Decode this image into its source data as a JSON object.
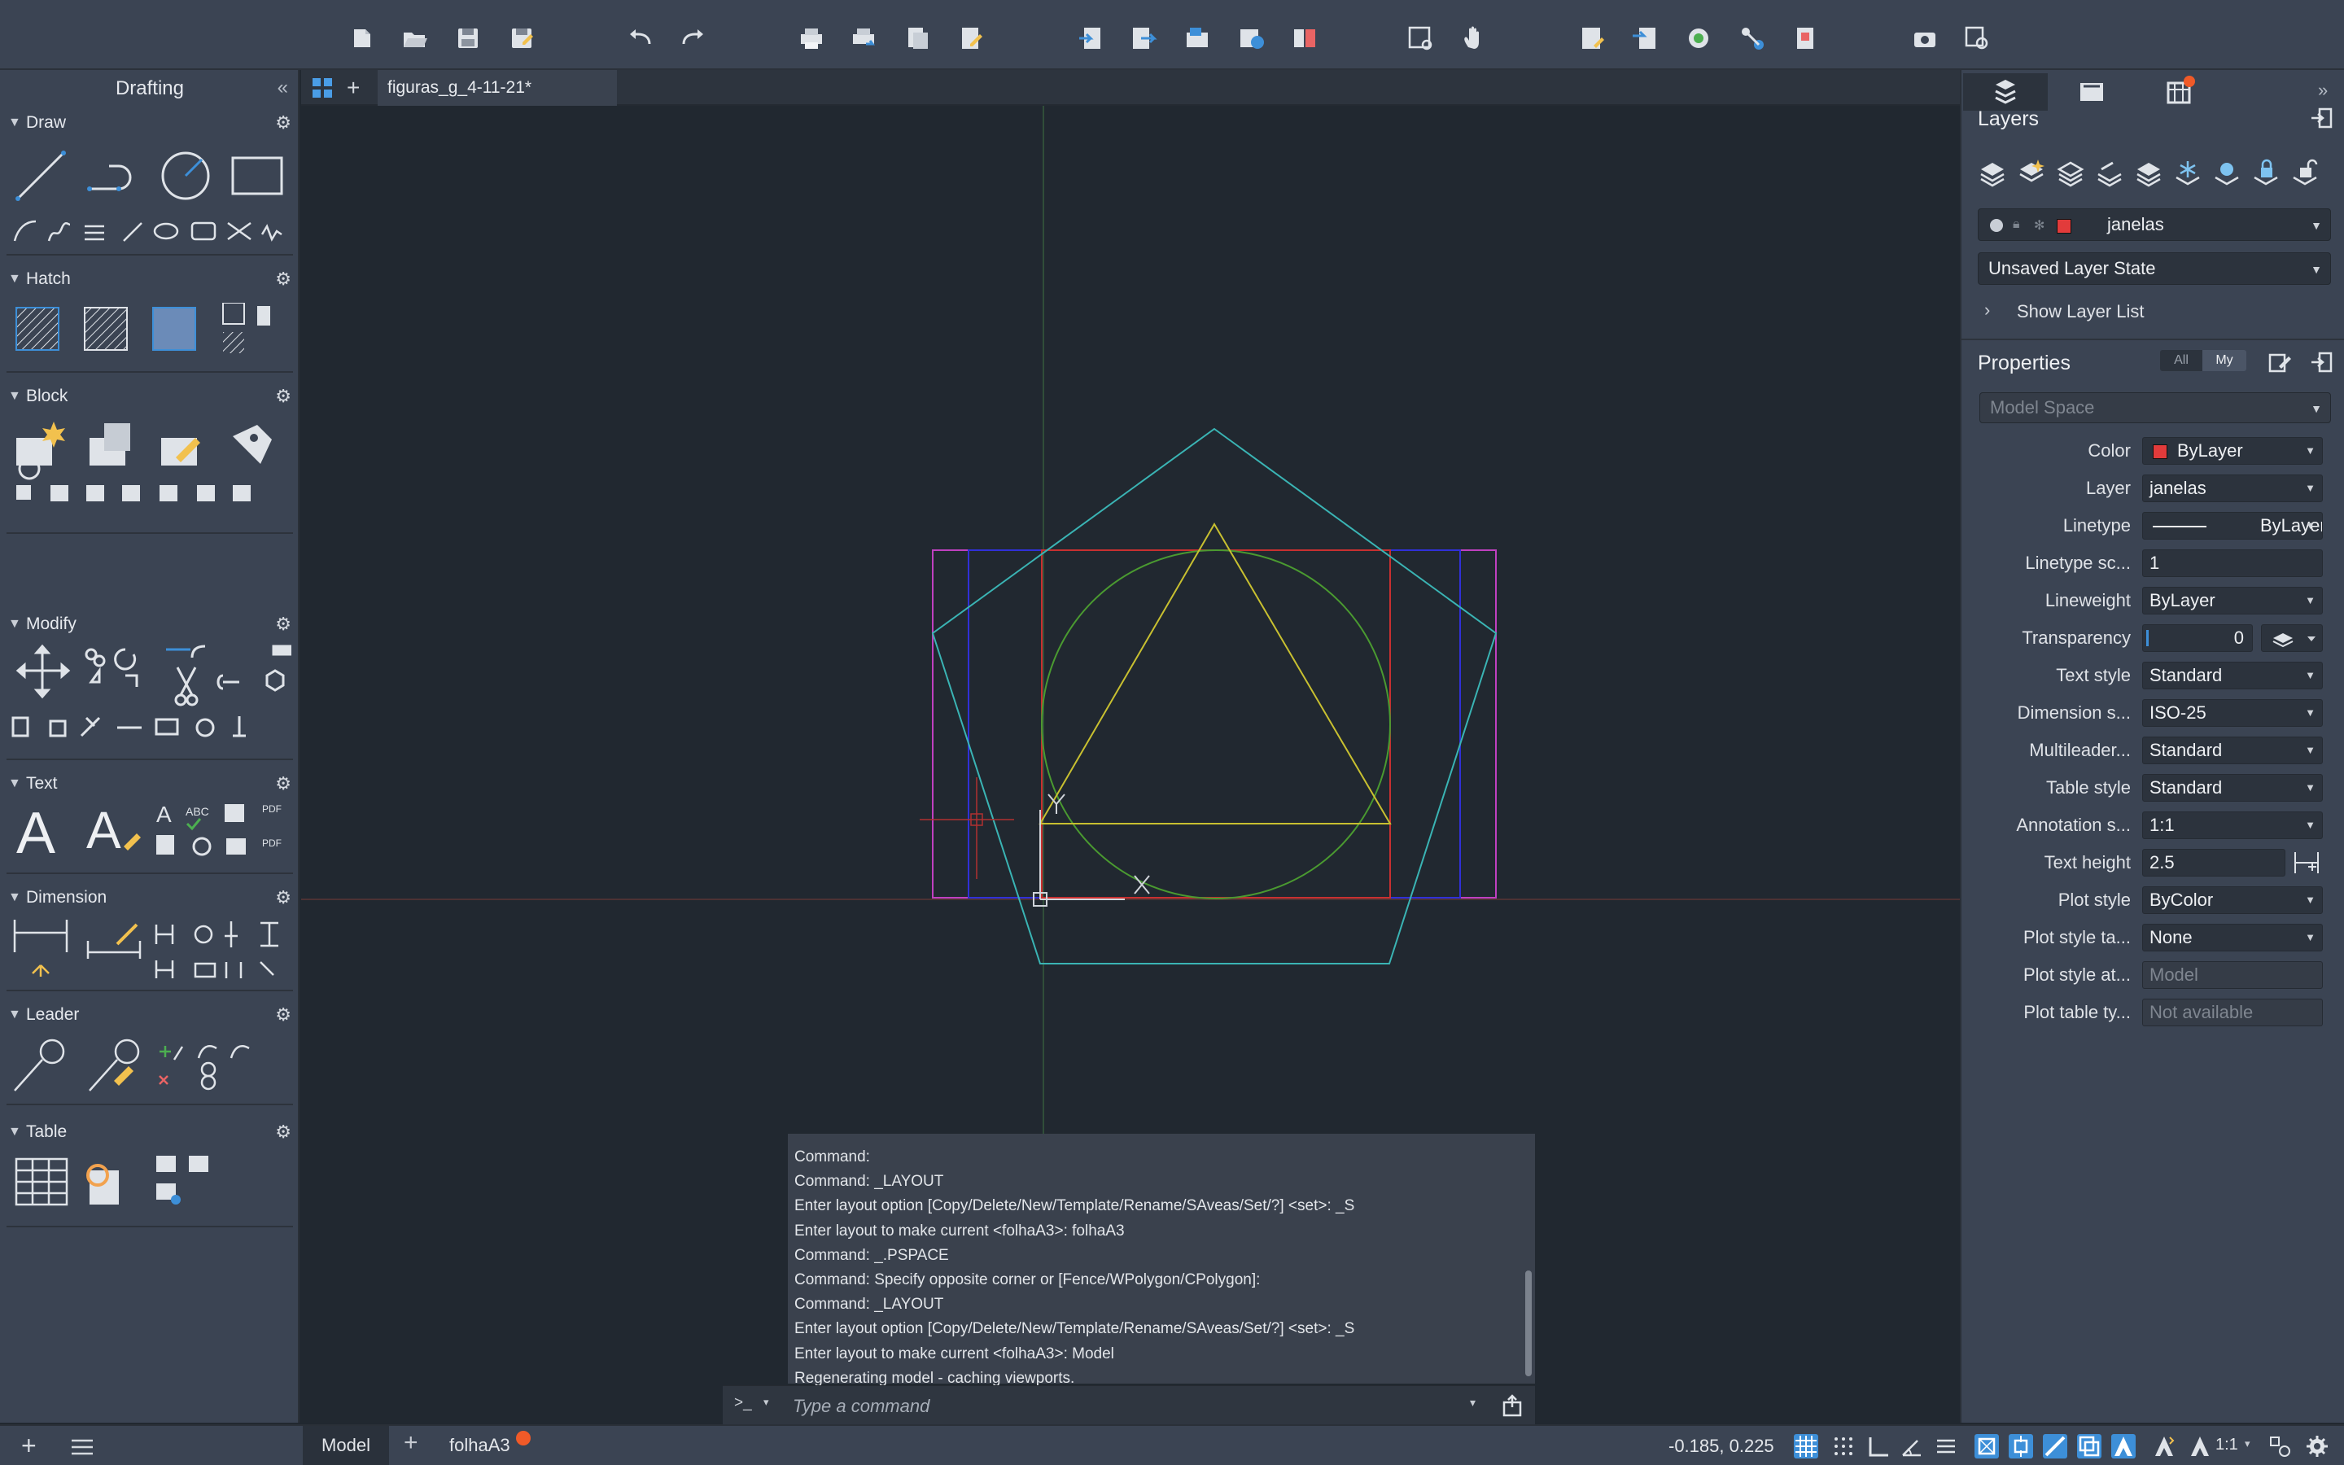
{
  "toolbar": {
    "icons": [
      "new-file",
      "open-file",
      "save",
      "save-as",
      "undo",
      "redo",
      "plot",
      "batch-plot",
      "plot-preview",
      "page-setup",
      "import",
      "export",
      "publish",
      "share",
      "compare",
      "zoom-window",
      "pan",
      "layer-properties",
      "match-layer",
      "xref",
      "attach",
      "insert",
      "camera",
      "find"
    ]
  },
  "palette": {
    "title": "Drafting",
    "collapse_glyph": "«",
    "sections": {
      "draw": "Draw",
      "hatch": "Hatch",
      "block": "Block",
      "modify": "Modify",
      "text": "Text",
      "dimension": "Dimension",
      "leader": "Leader",
      "table": "Table"
    }
  },
  "doc": {
    "tab_title": "figuras_g_4-11-21*"
  },
  "command": {
    "history": [
      "Command:",
      "Command: _LAYOUT",
      "Enter layout option [Copy/Delete/New/Template/Rename/SAveas/Set/?] <set>: _S",
      "Enter layout to make current <folhaA3>: folhaA3",
      "Command: _.PSPACE",
      "Command: Specify opposite corner or [Fence/WPolygon/CPolygon]:",
      "Command: _LAYOUT",
      "Enter layout option [Copy/Delete/New/Template/Rename/SAveas/Set/?] <set>: _S",
      "Enter layout to make current <folhaA3>: Model",
      "Regenerating model - caching viewports."
    ],
    "prompt_glyph": ">_",
    "placeholder": "Type a command"
  },
  "bottom": {
    "model_tab": "Model",
    "layout_tab": "folhaA3",
    "coords": "-0.185, 0.225",
    "scale": "1:1"
  },
  "layers": {
    "title": "Layers",
    "current_layer": "janelas",
    "layer_color": "#e23b3b",
    "layer_state": "Unsaved Layer State",
    "show_list": "Show Layer List"
  },
  "properties": {
    "title": "Properties",
    "filter_all": "All",
    "filter_my": "My",
    "space": "Model Space",
    "rows": [
      {
        "label": "Color",
        "value": "ByLayer"
      },
      {
        "label": "Layer",
        "value": "janelas"
      },
      {
        "label": "Linetype",
        "value": "ByLayer"
      },
      {
        "label": "Linetype sc...",
        "value": "1"
      },
      {
        "label": "Lineweight",
        "value": "ByLayer"
      },
      {
        "label": "Transparency",
        "value": "0"
      },
      {
        "label": "Text style",
        "value": "Standard"
      },
      {
        "label": "Dimension s...",
        "value": "ISO-25"
      },
      {
        "label": "Multileader...",
        "value": "Standard"
      },
      {
        "label": "Table style",
        "value": "Standard"
      },
      {
        "label": "Annotation s...",
        "value": "1:1"
      },
      {
        "label": "Text height",
        "value": "2.5"
      },
      {
        "label": "Plot style",
        "value": "ByColor"
      },
      {
        "label": "Plot style ta...",
        "value": "None"
      },
      {
        "label": "Plot style at...",
        "value": "Model"
      },
      {
        "label": "Plot table ty...",
        "value": "Not available"
      }
    ]
  },
  "colors": {
    "canvas": "#212830",
    "panel": "#3b4453",
    "accent": "#3d8fd8",
    "notify": "#f05a28"
  }
}
